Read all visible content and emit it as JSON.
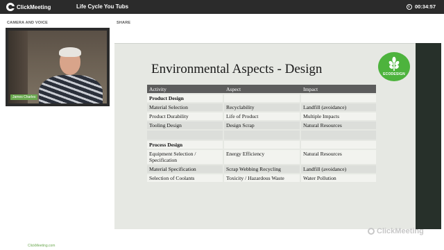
{
  "app": {
    "logo_text": "ClickMeeting",
    "event_title": "Life Cycle You Tubs",
    "timer": "00:34:57"
  },
  "left_panel": {
    "camera_label": "CAMERA AND VOICE",
    "presenter_name": "James Charles",
    "footer_link": "ClickMeeting.com"
  },
  "share": {
    "label": "SHARE",
    "watermark": "ClickMeeting"
  },
  "slide": {
    "title": "Environmental Aspects - Design",
    "badge_text": "ECODESIGN",
    "badge_color": "#4db33d",
    "columns": [
      "Activity",
      "Aspect",
      "Impact"
    ],
    "rows": [
      {
        "type": "section",
        "cells": [
          "Product Design",
          "",
          ""
        ]
      },
      {
        "type": "data",
        "cells": [
          "Material Selection",
          "Recyclability",
          "Landfill (avoidance)"
        ]
      },
      {
        "type": "data",
        "cells": [
          "Product Durability",
          "Life of Product",
          "Multiple Impacts"
        ]
      },
      {
        "type": "data",
        "cells": [
          "Tooling Design",
          "Design Scrap",
          "Natural Resources"
        ]
      },
      {
        "type": "spacer",
        "cells": [
          "",
          "",
          ""
        ]
      },
      {
        "type": "section",
        "cells": [
          "Process Design",
          "",
          ""
        ]
      },
      {
        "type": "data",
        "cells": [
          "Equipment Selection / Specification",
          "Energy Efficiency",
          "Natural Resources"
        ]
      },
      {
        "type": "data",
        "cells": [
          "Material Specification",
          "Scrap Webbing Recycling",
          "Landfill (avoidance)"
        ]
      },
      {
        "type": "data",
        "cells": [
          "Selection of Coolants",
          "Toxicity / Hazardous Waste",
          "Water Pollution"
        ]
      }
    ]
  }
}
